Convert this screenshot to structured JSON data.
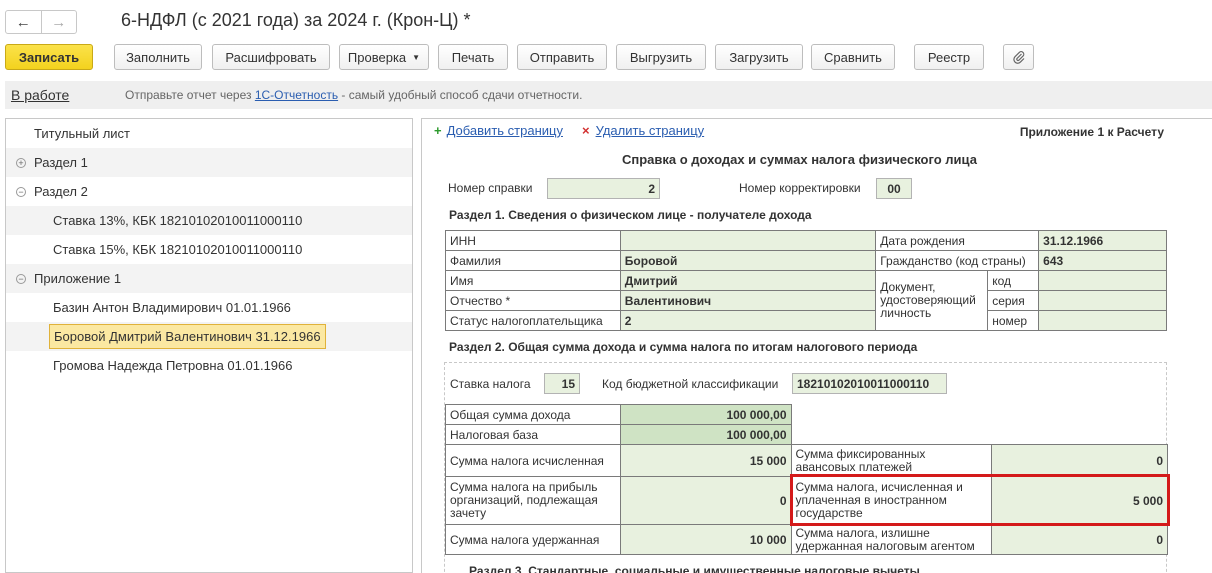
{
  "window": {
    "title": "6-НДФЛ (с 2021 года) за 2024 г. (Крон-Ц) *"
  },
  "nav": {
    "back": "←",
    "forward": "→"
  },
  "toolbar": {
    "save": "Записать",
    "fill": "Заполнить",
    "decode": "Расшифровать",
    "check": "Проверка",
    "print": "Печать",
    "send": "Отправить",
    "export": "Выгрузить",
    "import": "Загрузить",
    "compare": "Сравнить",
    "registry": "Реестр",
    "attach_icon": "paperclip-icon"
  },
  "status": {
    "state": "В работе",
    "info_prefix": "Отправьте отчет через ",
    "info_link": "1С-Отчетность",
    "info_suffix": " - самый удобный способ сдачи отчетности."
  },
  "tree": {
    "title_sheet": "Титульный лист",
    "section1": "Раздел 1",
    "section2": "Раздел 2",
    "rate13": "Ставка 13%, КБК 18210102010011000110",
    "rate15": "Ставка 15%, КБК 18210102010011000110",
    "appendix1": "Приложение 1",
    "person1": "Базин Антон Владимирович 01.01.1966",
    "person2": "Боровой Дмитрий Валентинович 31.12.1966",
    "person3": "Громова Надежда Петровна 01.01.1966"
  },
  "form": {
    "add_page": "Добавить страницу",
    "delete_page": "Удалить страницу",
    "appendix_label": "Приложение 1 к Расчету",
    "title": "Справка о доходах и суммах налога физического лица",
    "cert_no_label": "Номер справки",
    "cert_no": "2",
    "corr_no_label": "Номер корректировки",
    "corr_no": "00",
    "section1_title": "Раздел 1. Сведения о физическом лице - получателе дохода",
    "inn_label": "ИНН",
    "inn": "",
    "birth_label": "Дата рождения",
    "birth": "31.12.1966",
    "surname_label": "Фамилия",
    "surname": "Боровой",
    "citizenship_label": "Гражданство (код страны)",
    "citizenship": "643",
    "name_label": "Имя",
    "name": "Дмитрий",
    "doc_label": "Документ, удостоверяющий личность",
    "doc_code_label": "код",
    "doc_series_label": "серия",
    "doc_number_label": "номер",
    "patronymic_label": "Отчество *",
    "patronymic": "Валентинович",
    "taxpayer_status_label": "Статус налогоплательщика",
    "taxpayer_status": "2",
    "section2_title": "Раздел 2. Общая сумма дохода и сумма налога по итогам налогового периода",
    "tax_rate_label": "Ставка налога",
    "tax_rate": "15",
    "kbk_label": "Код бюджетной классификации",
    "kbk": "18210102010011000110",
    "total_income_label": "Общая сумма дохода",
    "total_income": "100 000,00",
    "tax_base_label": "Налоговая база",
    "tax_base": "100 000,00",
    "tax_calc_label": "Сумма налога исчисленная",
    "tax_calc": "15 000",
    "fixed_adv_label": "Сумма фиксированных авансовых платежей",
    "fixed_adv": "0",
    "profit_tax_label": "Сумма налога на прибыль организаций, подлежащая зачету",
    "profit_tax": "0",
    "foreign_tax_label": "Сумма налога, исчисленная и уплаченная в иностранном государстве",
    "foreign_tax": "5 000",
    "tax_withheld_label": "Сумма налога удержанная",
    "tax_withheld": "10 000",
    "excess_withheld_label": "Сумма налога, излишне удержанная налоговым агентом",
    "excess_withheld": "0",
    "section3_title": "Раздел 3. Стандартные, социальные и имущественные налоговые вычеты"
  }
}
